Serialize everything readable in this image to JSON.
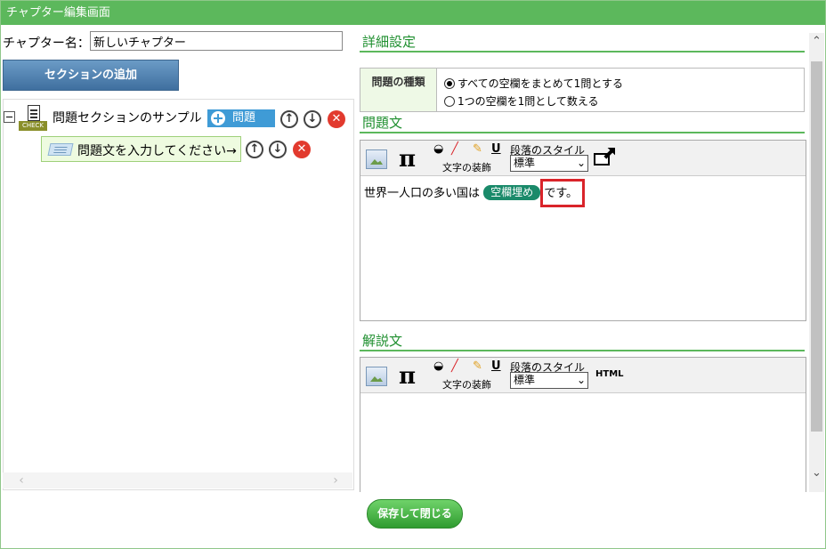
{
  "window": {
    "title": "チャプター編集画面"
  },
  "chapter": {
    "label": "チャプター名：",
    "name_value": "新しいチャプター"
  },
  "left": {
    "add_section_label": "セクションの追加",
    "tree": {
      "section": {
        "check_tag": "CHECK",
        "title": "問題セクションのサンプル",
        "add_question_label": "問題",
        "up_icon": "arrow-up-icon",
        "down_icon": "arrow-down-icon",
        "delete_icon": "delete-icon"
      },
      "question": {
        "text": "問題文を入力してください→"
      }
    }
  },
  "right": {
    "detail_heading": "詳細設定",
    "question_type": {
      "label": "問題の種類",
      "options": [
        {
          "text": "すべての空欄をまとめて1問とする",
          "selected": true
        },
        {
          "text": "1つの空欄を1問として数える",
          "selected": false
        }
      ]
    },
    "question_heading": "問題文",
    "question_editor": {
      "pi_symbol": "π",
      "deco_label": "文字の装飾",
      "underline_glyph": "U",
      "style_label": "段落のスタイル",
      "style_value": "標準",
      "text_before": "世界一人口の多い国は",
      "blank_chip": "空欄埋め",
      "text_after": "です。"
    },
    "explanation_heading": "解説文",
    "explanation_editor": {
      "pi_symbol": "π",
      "deco_label": "文字の装飾",
      "underline_glyph": "U",
      "style_label": "段落のスタイル",
      "style_value": "標準",
      "html_label": "HTML"
    }
  },
  "footer": {
    "save_label": "保存して閉じる"
  },
  "colors": {
    "accent": "#5cb85c",
    "heading": "#1f8f2f",
    "highlight": "#d9242a"
  }
}
